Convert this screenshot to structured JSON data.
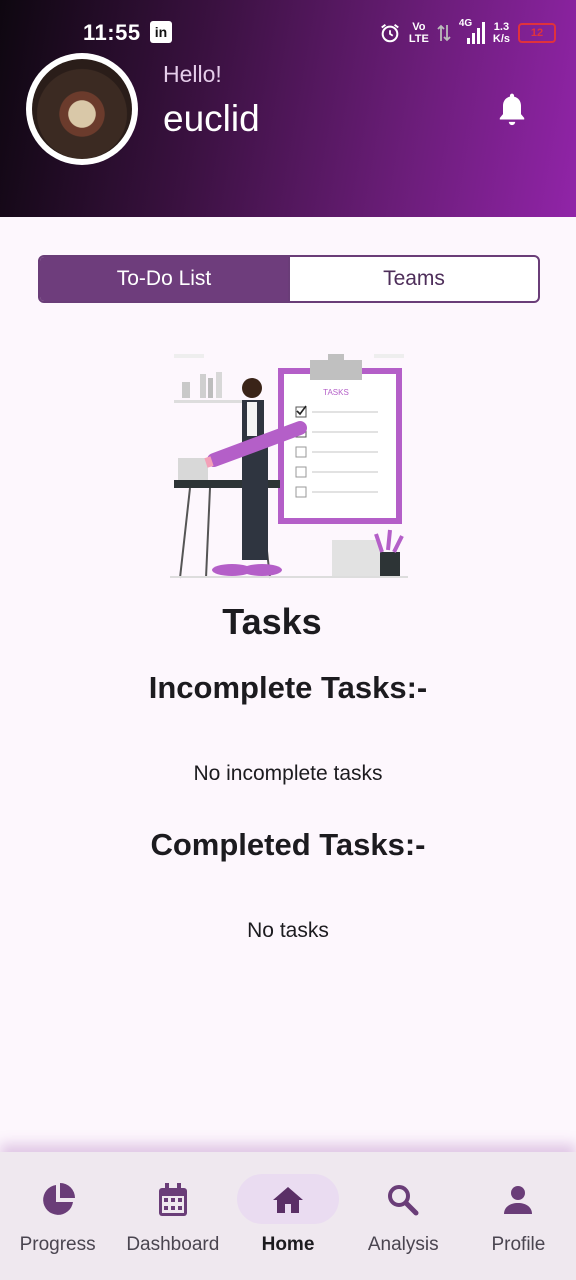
{
  "status_bar": {
    "time": "11:55",
    "app_badge": "in",
    "network_volte_top": "Vo",
    "network_volte_bottom": "LTE",
    "network_type": "4G",
    "speed_value": "1.3",
    "speed_unit": "K/s",
    "battery": "12"
  },
  "header": {
    "greeting": "Hello!",
    "username": "euclid"
  },
  "segments": {
    "todo_label": "To-Do List",
    "teams_label": "Teams"
  },
  "illustration": {
    "clipboard_title": "TASKS"
  },
  "content": {
    "title": "Tasks",
    "incomplete_heading": "Incomplete Tasks:-",
    "incomplete_empty": "No incomplete tasks",
    "completed_heading": "Completed Tasks:-",
    "completed_empty": "No tasks"
  },
  "bottom_nav": {
    "items": [
      {
        "label": "Progress",
        "icon": "pie-chart-icon"
      },
      {
        "label": "Dashboard",
        "icon": "calendar-icon"
      },
      {
        "label": "Home",
        "icon": "home-icon"
      },
      {
        "label": "Analysis",
        "icon": "search-icon"
      },
      {
        "label": "Profile",
        "icon": "person-icon"
      }
    ],
    "active_index": 2
  },
  "colors": {
    "primary": "#6e3d7c",
    "header_gradient_end": "#9124a8",
    "icon": "#6a3d78",
    "battery_warning": "#e0323c"
  }
}
